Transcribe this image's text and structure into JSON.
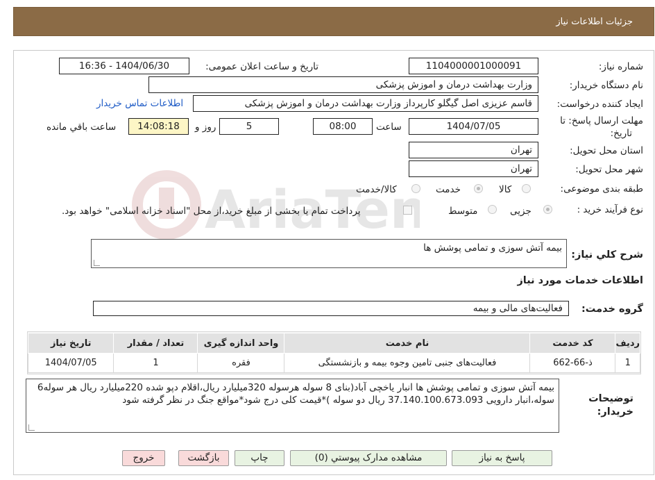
{
  "header": {
    "title": "جزئیات اطلاعات نیاز"
  },
  "watermark": {
    "text": "AriaTender.neT"
  },
  "form": {
    "need_number_label": "شماره نیاز:",
    "need_number_value": "1104000001000091",
    "announce_label": "تاریخ و ساعت اعلان عمومی:",
    "announce_value": "1404/06/30 - 16:36",
    "buyer_org_label": "نام دستگاه خریدار:",
    "buyer_org_value": "وزارت بهداشت  درمان و اموزش پزشکی",
    "requester_label": "ایجاد کننده درخواست:",
    "requester_value": "قاسم عزیزی اصل گیگلو کارپرداز وزارت بهداشت  درمان و اموزش پزشکی",
    "contact_link": "اطلاعات تماس خریدار",
    "deadline_label_1": "مهلت ارسال پاسخ: تا",
    "deadline_label_2": "تاریخ:",
    "deadline_date": "1404/07/05",
    "time_label": "ساعت",
    "deadline_time": "08:00",
    "days_value": "5",
    "days_label": "روز و",
    "remaining_time": "14:08:18",
    "remaining_label": "ساعت باقي مانده",
    "province_label": "استان محل تحویل:",
    "province_value": "تهران",
    "city_label": "شهر محل تحویل:",
    "city_value": "تهران",
    "category_label": "طبقه بندی موضوعی:",
    "category_options": [
      "کالا",
      "خدمت",
      "کالا/خدمت"
    ],
    "category_selected": "خدمت",
    "process_label": "نوع فرآیند خرید :",
    "process_options": [
      "جزیی",
      "متوسط"
    ],
    "process_selected": "جزیی",
    "payment_note": "پرداخت تمام یا بخشی از مبلغ خرید،از محل \"اسناد خزانه اسلامی\" خواهد بود.",
    "description_label": "شرح كلي نياز:",
    "description_value": "بیمه آتش سوزی و تمامی پوشش ها",
    "services_heading": "اطلاعات خدمات مورد نياز",
    "service_group_label": "گروه خدمت:",
    "service_group_value": "فعالیت‌های مالی و بیمه"
  },
  "table": {
    "headers": [
      "ردیف",
      "کد خدمت",
      "نام خدمت",
      "واحد اندازه گیری",
      "تعداد / مقدار",
      "تاریخ نیاز"
    ],
    "rows": [
      [
        "1",
        "ذ-66-662",
        "فعالیت‌های جنبی تامین وجوه بیمه و بازنشستگی",
        "فقره",
        "1",
        "1404/07/05"
      ]
    ]
  },
  "buyer_notes": {
    "label_1": "توضیحات",
    "label_2": "خریدار:",
    "text": "بیمه آتش سوزی و تمامی پوشش ها انبار یاخچی آباد(بنای 8 سوله هرسوله 320میلیارد ریال،اقلام دپو شده 220میلیارد ریال هر سوله6 سوله،انبار دارویی 37.140.100.673.093 ریال دو سوله )*قیمت کلی درج شود*مواقع جنگ در نظر گرفته شود"
  },
  "buttons": {
    "respond": "پاسخ به نیاز",
    "attachments": "مشاهده مدارک پیوستي (0)",
    "print": "چاپ",
    "back": "بازگشت",
    "exit": "خروج"
  }
}
